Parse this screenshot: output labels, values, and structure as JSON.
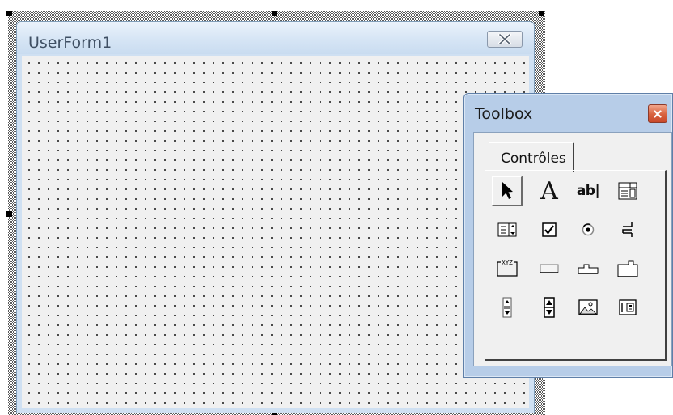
{
  "userform": {
    "title": "UserForm1",
    "close_icon": "close-x-icon"
  },
  "toolbox": {
    "title": "Toolbox",
    "close_icon": "close-x-icon",
    "tab_label": "Contrôles",
    "tools": [
      {
        "name": "select-objects",
        "icon": "pointer-arrow-icon"
      },
      {
        "name": "label",
        "icon": "label-a-icon",
        "glyph": "A"
      },
      {
        "name": "textbox",
        "icon": "textbox-icon",
        "text": "ab|"
      },
      {
        "name": "combobox",
        "icon": "combobox-icon"
      },
      {
        "name": "listbox",
        "icon": "listbox-icon"
      },
      {
        "name": "checkbox",
        "icon": "checkbox-icon"
      },
      {
        "name": "optionbutton",
        "icon": "option-button-icon"
      },
      {
        "name": "togglebutton",
        "icon": "toggle-button-icon"
      },
      {
        "name": "frame",
        "icon": "frame-icon",
        "text": "XYZ"
      },
      {
        "name": "commandbutton",
        "icon": "command-button-icon"
      },
      {
        "name": "tabstrip",
        "icon": "tabstrip-icon"
      },
      {
        "name": "multipage",
        "icon": "multipage-icon"
      },
      {
        "name": "scrollbar",
        "icon": "scrollbar-icon"
      },
      {
        "name": "spinbutton",
        "icon": "spinbutton-icon"
      },
      {
        "name": "image",
        "icon": "image-icon"
      },
      {
        "name": "refedit",
        "icon": "refedit-icon"
      }
    ]
  },
  "colors": {
    "form_title_text": "#3f4f63",
    "toolbox_close_bg": "#d8623f",
    "client_bg": "#f0f0f0"
  }
}
